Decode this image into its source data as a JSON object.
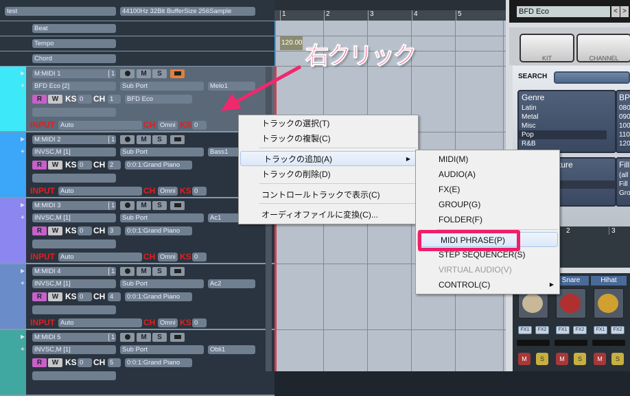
{
  "project": {
    "name": "test",
    "audio_info": "44100Hz 32Bit BufferSize 256Sample"
  },
  "control_tracks": [
    "Beat",
    "Tempo",
    "Chord"
  ],
  "tracks": [
    {
      "name": "M:MIDI 1",
      "num": "1",
      "instrument": "BFD Eco [2]",
      "port": "Sub Port",
      "part": "Melo1",
      "ks": "0",
      "ch": "1",
      "program": "BFD Eco",
      "input": "Auto",
      "input_ch": "Omni",
      "input_ks": "0",
      "color": "#3de8f8",
      "selected": true
    },
    {
      "name": "M:MIDI 2",
      "num": "1",
      "instrument": "INVSC,M [1]",
      "port": "Sub Port",
      "part": "Bass1",
      "ks": "0",
      "ch": "2",
      "program": "0:0:1:Grand Piano",
      "input": "Auto",
      "input_ch": "Omni",
      "input_ks": "0",
      "color": "#3ca6f8"
    },
    {
      "name": "M:MIDI 3",
      "num": "1",
      "instrument": "INVSC,M [1]",
      "port": "Sub Port",
      "part": "Ac1",
      "ks": "0",
      "ch": "3",
      "program": "0:0:1:Grand Piano",
      "input": "Auto",
      "input_ch": "Omni",
      "input_ks": "0",
      "color": "#8c86f0"
    },
    {
      "name": "M:MIDI 4",
      "num": "1",
      "instrument": "INVSC,M [1]",
      "port": "Sub Port",
      "part": "Ac2",
      "ks": "0",
      "ch": "4",
      "program": "0:0:1:Grand Piano",
      "input": "Auto",
      "input_ch": "Omni",
      "input_ks": "0",
      "color": "#6a8cc8"
    },
    {
      "name": "M:MIDI 5",
      "num": "1",
      "instrument": "INVSC,M [1]",
      "port": "Sub Port",
      "part": "Obli1",
      "ks": "0",
      "ch": "5",
      "program": "0:0:1:Grand Piano",
      "color": "#40a8a0"
    }
  ],
  "labels": {
    "m": "M",
    "s": "S",
    "r": "R",
    "w": "W",
    "ks": "KS",
    "ch": "CH",
    "input": "INPUT"
  },
  "timeline": {
    "measures": [
      "1",
      "2",
      "3",
      "4",
      "5"
    ],
    "tempo": "120.00"
  },
  "annotation": {
    "text": "右クリック",
    "color": "#f0286c"
  },
  "context_menu": {
    "items": [
      "トラックの選択(T)",
      "トラックの複製(C)",
      "トラックの追加(A)",
      "トラックの削除(D)",
      "コントロールトラックで表示(C)",
      "オーディオファイルに変換(C)..."
    ],
    "highlighted": "トラックの追加(A)"
  },
  "submenu": {
    "items": [
      "MIDI(M)",
      "AUDIO(A)",
      "FX(E)",
      "GROUP(G)",
      "FOLDER(F)",
      "MIDI PHRASE(P)",
      "STEP SEQUENCER(S)",
      "VIRTUAL AUDIO(V)",
      "CONTROL(C)"
    ],
    "highlighted": "MIDI PHRASE(P)",
    "disabled": "VIRTUAL AUDIO(V)"
  },
  "plugin": {
    "title": "BFD Eco",
    "tabs": [
      "KIT",
      "CHANNEL"
    ],
    "search_label": "SEARCH",
    "genre_header": "Genre",
    "genres": [
      "Latin",
      "Metal",
      "Misc",
      "Pop",
      "R&B"
    ],
    "selected_genre": "Pop",
    "bpm_header": "BP",
    "bpms": [
      "080",
      "090",
      "100",
      "110",
      "120"
    ],
    "feature_header": "ture",
    "fill_header": "Fill",
    "fills": [
      "(all",
      "Fill",
      "Gro"
    ],
    "ruler": [
      "2",
      "3"
    ],
    "channels": [
      "Snare",
      "Hihat"
    ],
    "fx": [
      "FX1",
      "FX2"
    ],
    "m": "M",
    "s": "S"
  }
}
